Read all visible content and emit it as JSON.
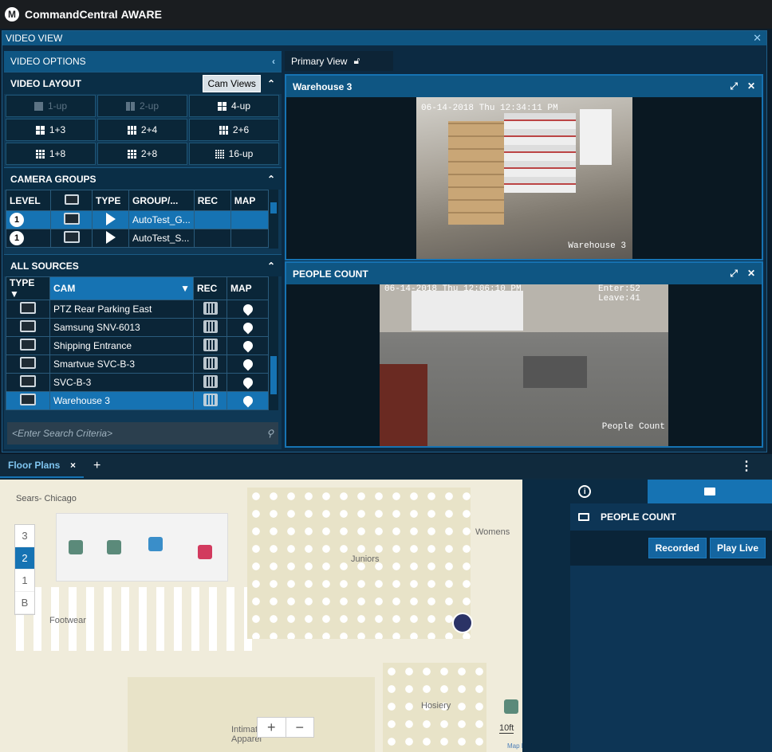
{
  "app": {
    "title": "CommandCentral",
    "title_bold": "AWARE",
    "logo": "M"
  },
  "video_view": {
    "title": "VIDEO VIEW"
  },
  "video_options": {
    "title": "VIDEO OPTIONS"
  },
  "video_layout": {
    "title": "VIDEO LAYOUT",
    "cam_views_label": "Cam Views",
    "buttons": [
      {
        "label": "1-up",
        "enabled": false
      },
      {
        "label": "2-up",
        "enabled": false
      },
      {
        "label": "4-up",
        "enabled": true
      },
      {
        "label": "1+3",
        "enabled": true
      },
      {
        "label": "2+4",
        "enabled": true
      },
      {
        "label": "2+6",
        "enabled": true
      },
      {
        "label": "1+8",
        "enabled": true
      },
      {
        "label": "2+8",
        "enabled": true
      },
      {
        "label": "16-up",
        "enabled": true
      }
    ]
  },
  "camera_groups": {
    "title": "CAMERA GROUPS",
    "columns": [
      "LEVEL",
      "",
      "TYPE",
      "GROUP/...",
      "REC",
      "MAP"
    ],
    "rows": [
      {
        "level": "1",
        "group": "AutoTest_G...",
        "selected": true
      },
      {
        "level": "1",
        "group": "AutoTest_S...",
        "selected": false
      }
    ]
  },
  "all_sources": {
    "title": "ALL SOURCES",
    "columns": [
      "TYPE",
      "CAM",
      "REC",
      "MAP"
    ],
    "rows": [
      {
        "cam": "PTZ Rear Parking East",
        "selected": false
      },
      {
        "cam": "Samsung SNV-6013",
        "selected": false
      },
      {
        "cam": "Shipping Entrance",
        "selected": false
      },
      {
        "cam": "Smartvue SVC-B-3",
        "selected": false
      },
      {
        "cam": "SVC-B-3",
        "selected": false
      },
      {
        "cam": "Warehouse 3",
        "selected": true
      }
    ],
    "search_placeholder": "<Enter Search Criteria>"
  },
  "primary_view": {
    "tab": "Primary View"
  },
  "feeds": [
    {
      "title": "Warehouse 3",
      "timestamp": "06-14-2018 Thu 12:34:11 PM",
      "overlay": "Warehouse 3"
    },
    {
      "title": "PEOPLE COUNT",
      "timestamp": "06-14-2018 Thu 12:06:10 PM",
      "counter_enter": "Enter:52",
      "counter_leave": "Leave:41",
      "overlay": "People Count"
    }
  ],
  "floor_plans": {
    "tab": "Floor Plans",
    "close": "×",
    "add": "+",
    "floors": [
      "3",
      "2",
      "1",
      "B"
    ],
    "active_floor": "2",
    "labels": {
      "sears": "Sears- Chicago",
      "footwear": "Footwear",
      "juniors": "Juniors",
      "womens": "Womens",
      "hosiery": "Hosiery",
      "intimate": "Intimate Apparel",
      "scale": "10ft",
      "attribution": "Map Data ©Micello"
    },
    "zoom_in": "+",
    "zoom_out": "−"
  },
  "side_panel": {
    "camera_name": "PEOPLE COUNT",
    "recorded_label": "Recorded",
    "play_live_label": "Play Live"
  },
  "colors": {
    "accent": "#1673b3",
    "header": "#0f5683",
    "camera_pin": "#2b3366"
  }
}
